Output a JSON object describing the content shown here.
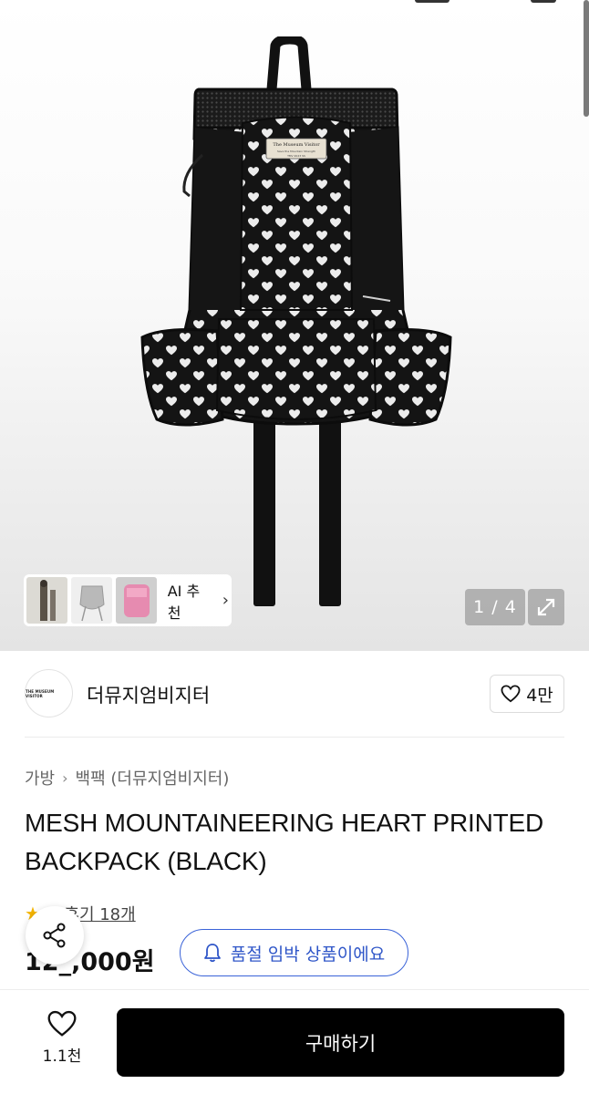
{
  "gallery": {
    "counter": "1 / 4",
    "ai_recommend_label": "AI 추천",
    "thumbnails": [
      "model-outfit",
      "gray-bag",
      "pink-item"
    ]
  },
  "brand": {
    "logo_text": "THE MUSEUM VISITOR",
    "name": "더뮤지엄비지터",
    "like_count": "4만"
  },
  "product": {
    "breadcrumb": [
      "가방",
      "백팩 (더뮤지엄비지터)"
    ],
    "title": "MESH MOUNTAINEERING HEART PRINTED BACKPACK (BLACK)",
    "rating_partial": "0",
    "review_label": "후기 18개",
    "price": "12_,000원",
    "soldout_notice": "품절 임박 상품이에요"
  },
  "bag_label": {
    "line1": "The Museum Visitor",
    "line2": "Save the Mountain Strength",
    "line3": "TMV 2023 SS"
  },
  "bottom": {
    "wish_count": "1.1천",
    "buy_label": "구매하기"
  },
  "colors": {
    "accent_blue": "#3a63d8",
    "buy_button": "#000000",
    "star": "#f4b400"
  }
}
